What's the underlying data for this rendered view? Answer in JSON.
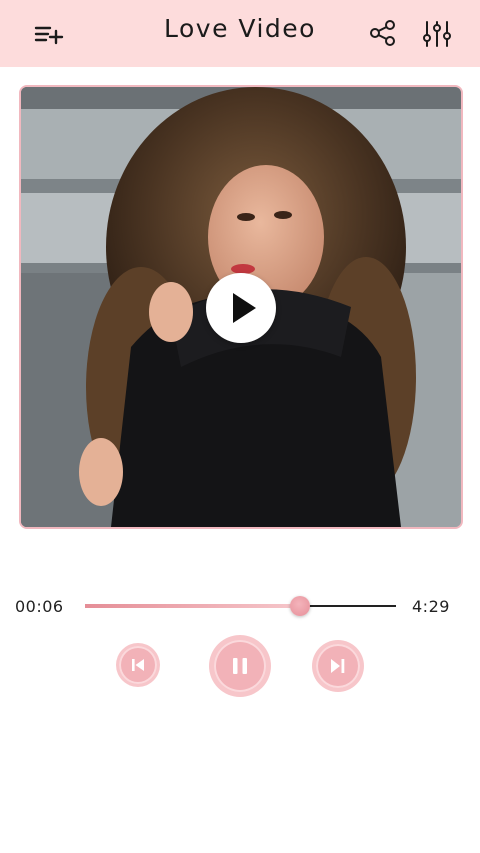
{
  "header": {
    "title": "Love Video",
    "left_icon": "playlist-add-icon",
    "share_icon": "share-icon",
    "equalizer_icon": "equalizer-icon",
    "background": "#fddcdc"
  },
  "video": {
    "thumbnail": "woman-curly-hair-photo",
    "play_icon": "play-icon"
  },
  "player": {
    "elapsed": "00:06",
    "duration": "4:29",
    "progress_percent": 69,
    "controls": [
      "previous-icon",
      "pause-icon",
      "next-icon"
    ]
  },
  "colors": {
    "accent": "#f2b2b8",
    "accent_dark": "#e58e97",
    "frame_border": "#f1b8bf",
    "text": "#1b1b1b"
  }
}
